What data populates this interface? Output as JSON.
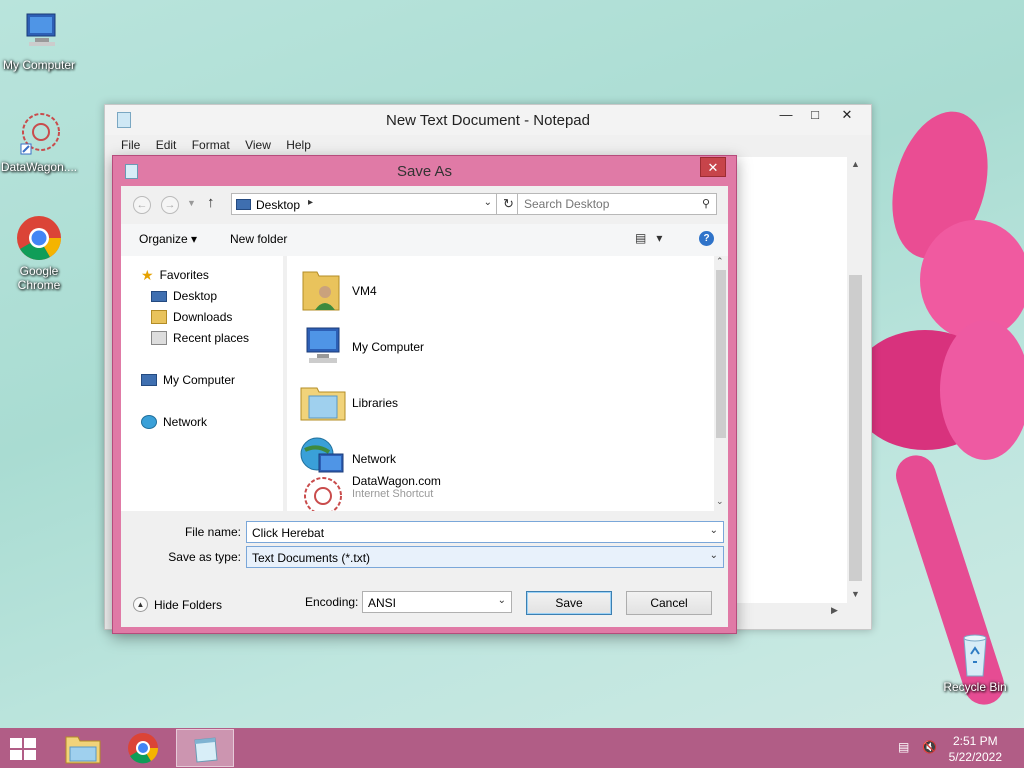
{
  "desktop": {
    "icons": [
      {
        "label": "My Computer"
      },
      {
        "label": "DataWagon...."
      },
      {
        "label": "Google Chrome"
      },
      {
        "label": "Recycle Bin"
      }
    ]
  },
  "notepad": {
    "title": "New Text Document - Notepad",
    "menu": [
      "File",
      "Edit",
      "Format",
      "View",
      "Help"
    ]
  },
  "save_as": {
    "title": "Save As",
    "address": "Desktop",
    "search_placeholder": "Search Desktop",
    "toolbar": {
      "organize": "Organize",
      "new_folder": "New folder"
    },
    "nav": {
      "favorites": "Favorites",
      "desktop": "Desktop",
      "downloads": "Downloads",
      "recent": "Recent places",
      "my_computer": "My Computer",
      "network": "Network"
    },
    "files": [
      {
        "name": "VM4"
      },
      {
        "name": "My Computer"
      },
      {
        "name": "Libraries"
      },
      {
        "name": "Network"
      },
      {
        "name": "DataWagon.com",
        "sub": "Internet Shortcut"
      }
    ],
    "file_name_label": "File name:",
    "file_name_value": "Click Herebat",
    "save_type_label": "Save as type:",
    "save_type_value": "Text Documents (*.txt)",
    "hide_folders": "Hide Folders",
    "encoding_label": "Encoding:",
    "encoding_value": "ANSI",
    "save_button": "Save",
    "cancel_button": "Cancel"
  },
  "taskbar": {
    "time": "2:51 PM",
    "date": "5/22/2022"
  },
  "colors": {
    "accent": "#e07aa6",
    "taskbar": "#b15d86",
    "close": "#c7444a"
  }
}
